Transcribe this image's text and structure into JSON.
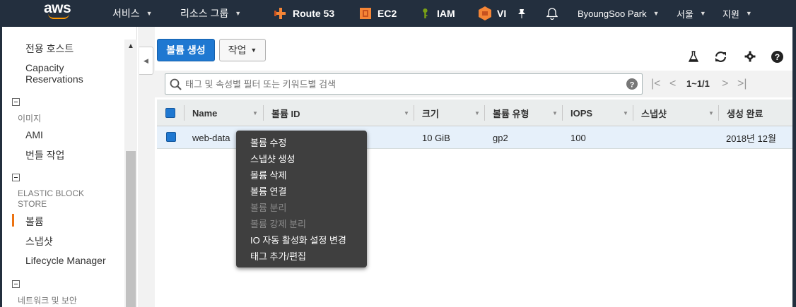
{
  "topnav": {
    "logo_text": "aws",
    "services": "서비스",
    "resource_groups": "리소스 그룹",
    "shortcuts": [
      {
        "label": "Route 53",
        "icon": "route53-icon",
        "color": "#f58536"
      },
      {
        "label": "EC2",
        "icon": "ec2-icon",
        "color": "#f58536"
      },
      {
        "label": "IAM",
        "icon": "iam-key-icon",
        "color": "#7aa116"
      },
      {
        "label": "VI",
        "icon": "vpc-icon",
        "color": "#f58536"
      }
    ],
    "user": "ByoungSoo Park",
    "region": "서울",
    "support": "지원"
  },
  "sidebar": {
    "top_links": [
      "전용 호스트",
      "Capacity",
      "Reservations"
    ],
    "images_header": "이미지",
    "images_items": [
      "AMI",
      "번들 작업"
    ],
    "ebs_header": [
      "ELASTIC BLOCK",
      "STORE"
    ],
    "ebs_items": [
      "볼륨",
      "스냅샷",
      "Lifecycle Manager"
    ],
    "network_header": "네트워크 및 보안",
    "active_item": "볼륨"
  },
  "toolbar": {
    "create_label": "볼륨 생성",
    "actions_label": "작업"
  },
  "search": {
    "placeholder": "태그 및 속성별 필터 또는 키워드별 검색",
    "value": ""
  },
  "pagination": {
    "label": "1~1/1"
  },
  "table": {
    "columns": [
      "Name",
      "볼륨 ID",
      "크기",
      "볼륨 유형",
      "IOPS",
      "스냅샷",
      "생성 완료"
    ],
    "rows": [
      {
        "name": "web-data",
        "volume_id": "",
        "size": "10 GiB",
        "type": "gp2",
        "iops": "100",
        "snapshot": "",
        "created": "2018년 12월",
        "selected": true
      }
    ]
  },
  "context_menu": {
    "items": [
      {
        "label": "볼륨 수정",
        "enabled": true
      },
      {
        "label": "스냅샷 생성",
        "enabled": true
      },
      {
        "label": "볼륨 삭제",
        "enabled": true
      },
      {
        "label": "볼륨 연결",
        "enabled": true
      },
      {
        "label": "볼륨 분리",
        "enabled": false
      },
      {
        "label": "볼륨 강제 분리",
        "enabled": false
      },
      {
        "label": "IO 자동 활성화 설정 변경",
        "enabled": true
      },
      {
        "label": "태그 추가/편집",
        "enabled": true
      }
    ]
  },
  "colors": {
    "nav_bg": "#232f3e",
    "accent_orange": "#ec7211",
    "primary_blue": "#1f78d1",
    "selected_row": "#e6f0fa",
    "menu_bg": "#3f3f3f"
  }
}
